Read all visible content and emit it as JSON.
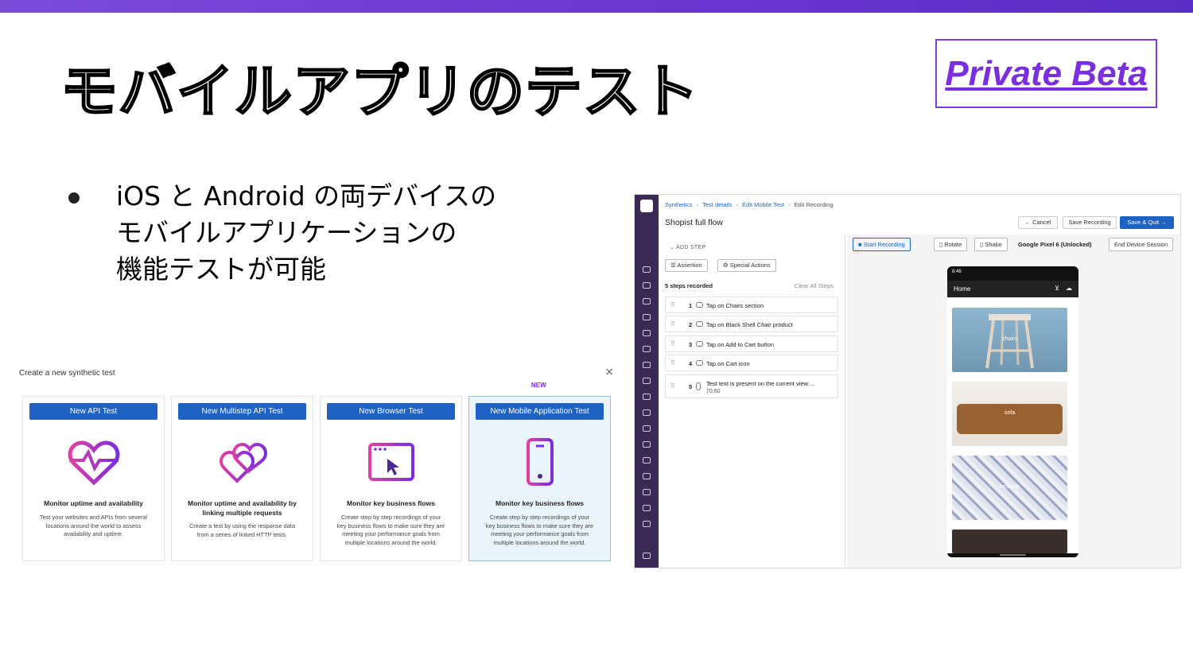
{
  "slide": {
    "title": "モバイルアプリのテスト",
    "beta_label": "Private Beta",
    "bullet_lines": [
      "iOS と Android の両デバイスの",
      "モバイルアプリケーションの",
      "機能テストが可能"
    ]
  },
  "create_dialog": {
    "title": "Create a new synthetic test",
    "close": "×",
    "new_tag": "NEW",
    "cards": [
      {
        "button": "New API Test",
        "heading": "Monitor uptime and availability",
        "desc": "Test your websites and APIs from several locations around the world to assess availability and uptime.",
        "icon": "heartbeat-icon"
      },
      {
        "button": "New Multistep API Test",
        "heading": "Monitor uptime and availability by linking multiple requests",
        "desc": "Create a test by using the response data from a series of linked HTTP tests.",
        "icon": "linked-hearts-icon"
      },
      {
        "button": "New Browser Test",
        "heading": "Monitor key business flows",
        "desc": "Create step by step recordings of your key business flows to make sure they are meeting your performance goals from multiple locations around the world.",
        "icon": "browser-cursor-icon"
      },
      {
        "button": "New Mobile Application  Test",
        "heading": "Monitor key business flows",
        "desc": "Create step by step recordings of your key business flows to make sure they are meeting your performance goals from multiple locations around the world.",
        "icon": "mobile-phone-icon"
      }
    ]
  },
  "recorder": {
    "breadcrumbs": [
      "Synthetics",
      "Test details",
      "Edit Mobile Test",
      "Edit Recording"
    ],
    "flow_title": "Shopist full flow",
    "cancel": "Cancel",
    "save_recording": "Save Recording",
    "save_quit": "Save & Quit",
    "add_step": "ADD STEP",
    "assertion": "Assertion",
    "special_actions": "Special Actions",
    "steps_recorded": "5 steps recorded",
    "clear_all": "Clear All Steps",
    "steps": [
      {
        "num": "1",
        "label": "Tap on Chairs section"
      },
      {
        "num": "2",
        "label": "Tap on Black Shell Chair product"
      },
      {
        "num": "3",
        "label": "Tap on Add to Cart button"
      },
      {
        "num": "4",
        "label": "Tap on Cart icon"
      },
      {
        "num": "5",
        "label": "Test text is present on the current view:...",
        "sub": "70.60"
      }
    ],
    "start_recording": "Start Recording",
    "rotate": "Rotate",
    "shake": "Shake",
    "device": "Google Pixel 6 (Unlocked)",
    "end_session": "End Device Session",
    "phone": {
      "status_time": "8:46",
      "home": "Home",
      "products": [
        "chairs",
        "sofa",
        "bedding"
      ]
    }
  },
  "colors": {
    "accent_purple": "#7b2de0",
    "primary_blue": "#1e63c4",
    "rail": "#3b2a55"
  }
}
